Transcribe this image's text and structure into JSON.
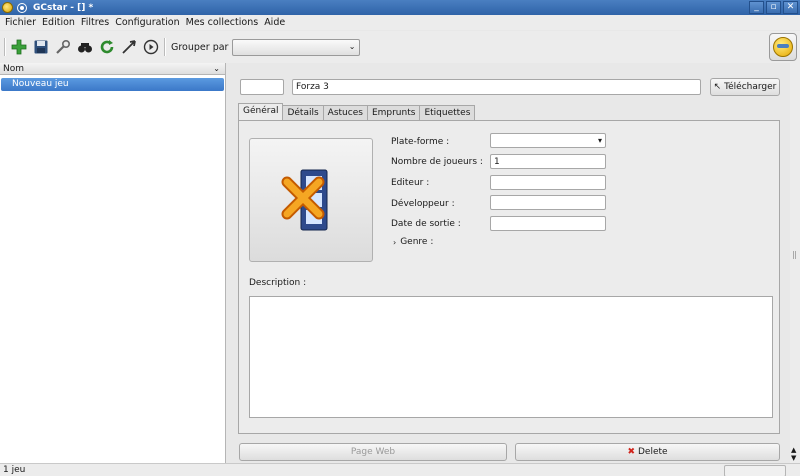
{
  "window": {
    "title": "GCstar - [] *",
    "minimize": "_",
    "restore": "▫",
    "close": "✕"
  },
  "menu": [
    "Fichier",
    "Edition",
    "Filtres",
    "Configuration",
    "Mes collections",
    "Aide"
  ],
  "toolbar": {
    "icons": [
      "add-icon",
      "save-icon",
      "settings-icon",
      "search-icon",
      "refresh-icon",
      "random-icon",
      "play-icon"
    ],
    "group_label": "Grouper par",
    "group_value": ""
  },
  "list": {
    "header": "Nom",
    "items": [
      "Nouveau jeu"
    ]
  },
  "detail": {
    "id_value": "",
    "name_value": "Forza 3",
    "download_label": "Télécharger",
    "tabs": [
      "Général",
      "Détails",
      "Astuces",
      "Emprunts",
      "Etiquettes"
    ],
    "active_tab": "Général",
    "fields": {
      "platform_label": "Plate-forme :",
      "platform_value": "",
      "players_label": "Nombre de joueurs :",
      "players_value": "1",
      "editor_label": "Editeur :",
      "editor_value": "",
      "developer_label": "Développeur :",
      "developer_value": "",
      "release_label": "Date de sortie :",
      "release_value": "",
      "genre_label": "Genre :"
    },
    "description_label": "Description :",
    "description_value": "",
    "web_label": "Page Web",
    "delete_label": "Delete"
  },
  "status": {
    "text": "1 jeu"
  },
  "colors": {
    "selection": "#3b78c8",
    "titlebar": "#2f63a8",
    "delete": "#d0241c"
  }
}
